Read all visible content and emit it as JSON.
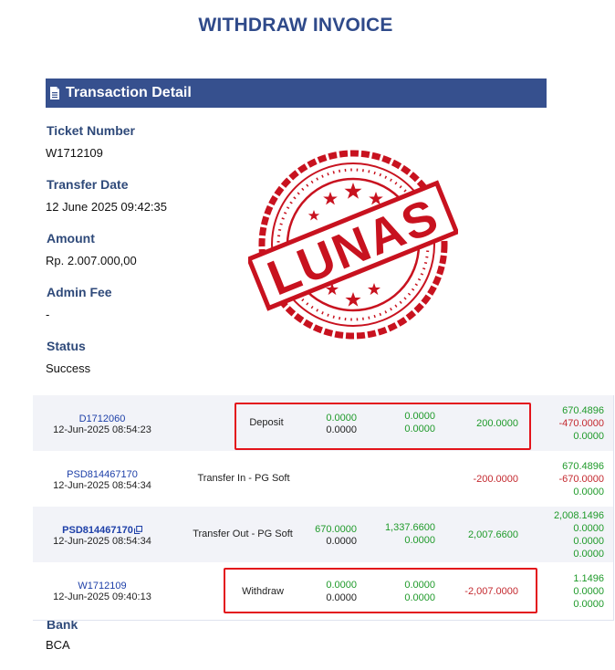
{
  "page_title": "WITHDRAW INVOICE",
  "section_title": "Transaction Detail",
  "fields": {
    "ticket_label": "Ticket Number",
    "ticket_value": "W1712109",
    "date_label": "Transfer Date",
    "date_value": "12 June 2025 09:42:35",
    "amount_label": "Amount",
    "amount_value": "Rp. 2.007.000,00",
    "fee_label": "Admin Fee",
    "fee_value": "-",
    "status_label": "Status",
    "status_value": "Success",
    "bank_label": "Bank",
    "bank_value": "BCA"
  },
  "stamp_text": "LUNAS",
  "transactions": [
    {
      "code": "D1712060",
      "date": "12-Jun-2025 08:54:23",
      "type": "Deposit",
      "col1": [
        "0.0000",
        "0.0000"
      ],
      "col2": [
        "0.0000",
        "0.0000"
      ],
      "col3": "200.0000",
      "balance": [
        "670.4896",
        "-470.0000",
        "0.0000"
      ]
    },
    {
      "code": "PSD814467170",
      "date": "12-Jun-2025 08:54:34",
      "type": "Transfer In - PG Soft",
      "col3": "-200.0000",
      "balance": [
        "670.4896",
        "-670.0000",
        "0.0000"
      ]
    },
    {
      "code": "PSD814467170",
      "date": "12-Jun-2025 08:54:34",
      "type": "Transfer Out - PG Soft",
      "col1": [
        "670.0000",
        "0.0000"
      ],
      "col2": [
        "1,337.6600",
        "0.0000"
      ],
      "col3": "2,007.6600",
      "balance": [
        "2,008.1496",
        "0.0000",
        "0.0000",
        "0.0000"
      ]
    },
    {
      "code": "W1712109",
      "date": "12-Jun-2025 09:40:13",
      "type": "Withdraw",
      "col1": [
        "0.0000",
        "0.0000"
      ],
      "col2": [
        "0.0000",
        "0.0000"
      ],
      "col3": "-2,007.0000",
      "balance": [
        "1.1496",
        "0.0000",
        "0.0000"
      ]
    }
  ],
  "colors": {
    "header": "#36508e",
    "title": "#2f4a8a",
    "positive": "#1f9a2a",
    "negative": "#c4292f",
    "highlight": "#e3131b",
    "stamp": "#c8121f"
  }
}
